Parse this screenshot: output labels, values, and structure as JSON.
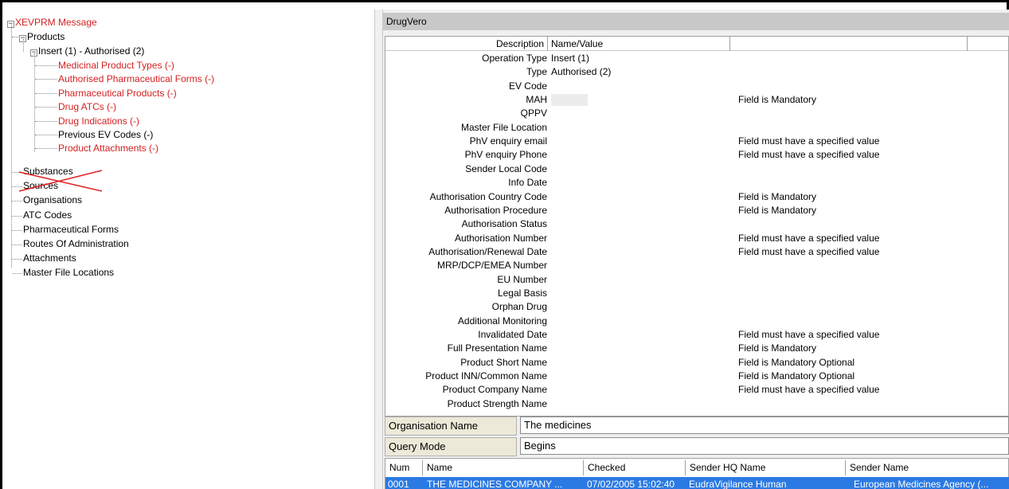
{
  "tree": {
    "root": "XEVPRM Message",
    "products": "Products",
    "insert": "Insert (1) - Authorised (2)",
    "children": [
      {
        "label": "Medicinal Product Types (-)",
        "red": true
      },
      {
        "label": "Authorised Pharmaceutical Forms (-)",
        "red": true
      },
      {
        "label": "Pharmaceutical Products (-)",
        "red": true
      },
      {
        "label": "Drug ATCs (-)",
        "red": true
      },
      {
        "label": "Drug Indications (-)",
        "red": true
      },
      {
        "label": "Previous EV Codes (-)",
        "red": false
      },
      {
        "label": "Product Attachments (-)",
        "red": true
      }
    ],
    "top_items": [
      "Substances",
      "Sources",
      "Organisations",
      "ATC Codes",
      "Pharmaceutical Forms",
      "Routes Of Administration",
      "Attachments",
      "Master File Locations"
    ]
  },
  "panel": {
    "title": "DrugVero",
    "headers": {
      "description": "Description",
      "value": "Name/Value"
    },
    "rows": [
      {
        "desc": "Operation Type",
        "value": "Insert (1)",
        "msg": ""
      },
      {
        "desc": "Type",
        "value": "Authorised (2)",
        "msg": ""
      },
      {
        "desc": "EV Code",
        "value": "",
        "msg": ""
      },
      {
        "desc": "MAH",
        "value": "",
        "msg": "Field is Mandatory",
        "masked": true
      },
      {
        "desc": "QPPV",
        "value": "",
        "msg": ""
      },
      {
        "desc": "Master File Location",
        "value": "",
        "msg": ""
      },
      {
        "desc": "PhV enquiry email",
        "value": "",
        "msg": "Field must have a specified value"
      },
      {
        "desc": "PhV enquiry Phone",
        "value": "",
        "msg": "Field must have a specified value"
      },
      {
        "desc": "Sender Local Code",
        "value": "",
        "msg": ""
      },
      {
        "desc": "Info Date",
        "value": "",
        "msg": ""
      },
      {
        "desc": "Authorisation Country Code",
        "value": "",
        "msg": "Field is Mandatory"
      },
      {
        "desc": "Authorisation Procedure",
        "value": "",
        "msg": "Field is Mandatory"
      },
      {
        "desc": "Authorisation Status",
        "value": "",
        "msg": ""
      },
      {
        "desc": "Authorisation Number",
        "value": "",
        "msg": "Field must have a specified value"
      },
      {
        "desc": "Authorisation/Renewal Date",
        "value": "",
        "msg": "Field must have a specified value"
      },
      {
        "desc": "MRP/DCP/EMEA Number",
        "value": "",
        "msg": ""
      },
      {
        "desc": "EU Number",
        "value": "",
        "msg": ""
      },
      {
        "desc": "Legal Basis",
        "value": "",
        "msg": ""
      },
      {
        "desc": "Orphan Drug",
        "value": "",
        "msg": ""
      },
      {
        "desc": "Additional Monitoring",
        "value": "",
        "msg": ""
      },
      {
        "desc": "Invalidated Date",
        "value": "",
        "msg": "Field must have a specified value"
      },
      {
        "desc": "Full Presentation Name",
        "value": "",
        "msg": "Field is Mandatory"
      },
      {
        "desc": "Product Short Name",
        "value": "",
        "msg": "Field is Mandatory Optional"
      },
      {
        "desc": "Product INN/Common Name",
        "value": "",
        "msg": "Field is Mandatory Optional"
      },
      {
        "desc": "Product Company Name",
        "value": "",
        "msg": "Field must have a specified value"
      },
      {
        "desc": "Product Strength Name",
        "value": "",
        "msg": ""
      }
    ]
  },
  "search": {
    "org_label": "Organisation Name",
    "org_value": "The medicines",
    "query_label": "Query Mode",
    "query_value": "Begins"
  },
  "results": {
    "headers": [
      "Num",
      "Name",
      "Checked",
      "Sender HQ Name",
      "Sender Name"
    ],
    "row": [
      "0001",
      "THE MEDICINES COMPANY ...",
      "07/02/2005 15:02:40",
      "EudraVigilance Human",
      "European Medicines Agency (..."
    ]
  },
  "colors": {
    "error_red": "#d42020",
    "selection_blue": "#2b7ae3"
  }
}
